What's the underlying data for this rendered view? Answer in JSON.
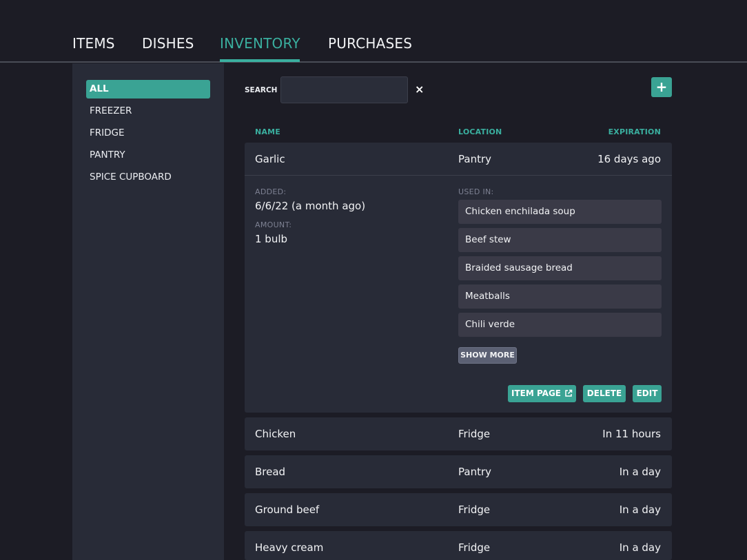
{
  "nav": {
    "tabs": [
      {
        "label": "ITEMS"
      },
      {
        "label": "DISHES"
      },
      {
        "label": "INVENTORY"
      },
      {
        "label": "PURCHASES"
      }
    ],
    "active": "INVENTORY"
  },
  "sidebar": {
    "items": [
      {
        "label": "ALL"
      },
      {
        "label": "FREEZER"
      },
      {
        "label": "FRIDGE"
      },
      {
        "label": "PANTRY"
      },
      {
        "label": "SPICE CUPBOARD"
      }
    ],
    "active": "ALL"
  },
  "search": {
    "label": "SEARCH",
    "value": "",
    "clear_icon": "×",
    "add_icon": "+"
  },
  "table": {
    "headers": {
      "name": "NAME",
      "location": "LOCATION",
      "expiration": "EXPIRATION"
    },
    "expanded": {
      "name": "Garlic",
      "location": "Pantry",
      "expiration": "16 days ago",
      "added_label": "ADDED:",
      "added_value": "6/6/22 (a month ago)",
      "amount_label": "AMOUNT:",
      "amount_value": "1 bulb",
      "used_in_label": "USED IN:",
      "used_in": [
        "Chicken enchilada soup",
        "Beef stew",
        "Braided sausage bread",
        "Meatballs",
        "Chili verde"
      ],
      "show_more": "SHOW MORE",
      "item_page": "ITEM PAGE",
      "delete": "DELETE",
      "edit": "EDIT"
    },
    "rows": [
      {
        "name": "Chicken",
        "location": "Fridge",
        "expiration": "In 11 hours"
      },
      {
        "name": "Bread",
        "location": "Pantry",
        "expiration": "In a day"
      },
      {
        "name": "Ground beef",
        "location": "Fridge",
        "expiration": "In a day"
      },
      {
        "name": "Heavy cream",
        "location": "Fridge",
        "expiration": "In a day"
      }
    ]
  },
  "colors": {
    "accent": "#3aaf9f",
    "accent_button": "#3aa394",
    "background": "#1c1c25",
    "panel": "#282b37"
  }
}
